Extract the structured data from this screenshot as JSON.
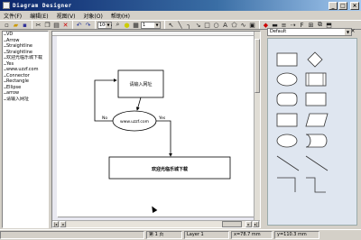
{
  "window": {
    "title": "Diagram Designer"
  },
  "menu": [
    "文件(F)",
    "编辑(E)",
    "视图(V)",
    "对象(O)",
    "帮助(H)"
  ],
  "toolbar": {
    "zoom": "100%",
    "grid": "1"
  },
  "tree_items": [
    "VD",
    "Arrow",
    "Straightline",
    "Straightline",
    "欢迎光临乐城下载",
    "Yes",
    "www.uzzf.com",
    "Connector",
    "Rectangle",
    "Ellipse",
    "arrow",
    "请输入网址"
  ],
  "diagram": {
    "rect1_label": "请输入网址",
    "ellipse_label": "www.uzzf.com",
    "yes_label": "Yes",
    "no_label": "No",
    "rect2_label": "欢迎光临乐城下载"
  },
  "palette": {
    "selected": "Default"
  },
  "status": {
    "page": "第 1 页",
    "layer": "Layer 1",
    "x": "x=78.7 mm",
    "y": "y=110.3 mm"
  }
}
